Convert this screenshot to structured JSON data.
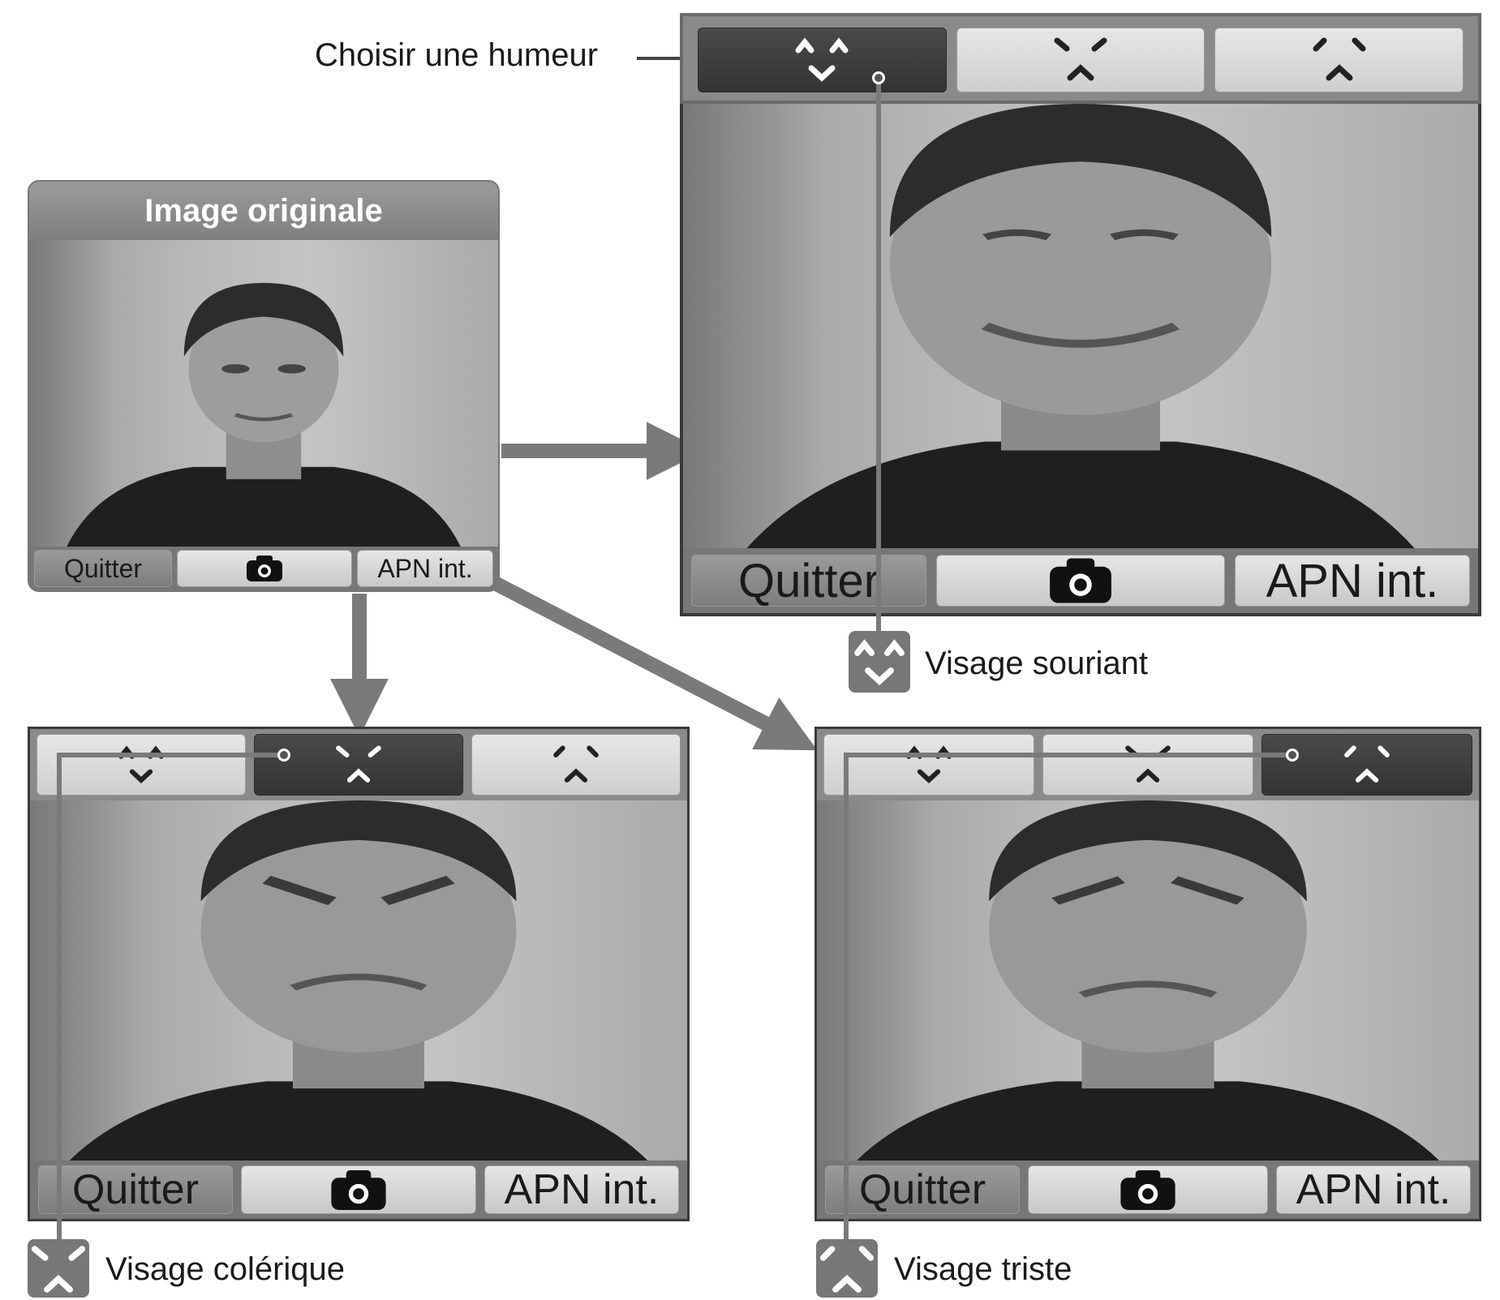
{
  "labels": {
    "choose_mood": "Choisir une humeur",
    "original_image": "Image originale",
    "smiling_face": "Visage souriant",
    "angry_face": "Visage colérique",
    "sad_face": "Visage triste"
  },
  "buttons": {
    "quit": "Quitter",
    "camera": "camera-icon",
    "apn": "APN int."
  },
  "moods": [
    "smile-mood-icon",
    "angry-mood-icon",
    "sad-mood-icon"
  ],
  "screens": {
    "smile": {
      "active_mood": "smile"
    },
    "angry": {
      "active_mood": "angry"
    },
    "sad": {
      "active_mood": "sad"
    }
  },
  "colors": {
    "active_tab": "#3a3a3a",
    "inactive_tab": "#d8d8d8",
    "connector": "#7a7a7a"
  }
}
